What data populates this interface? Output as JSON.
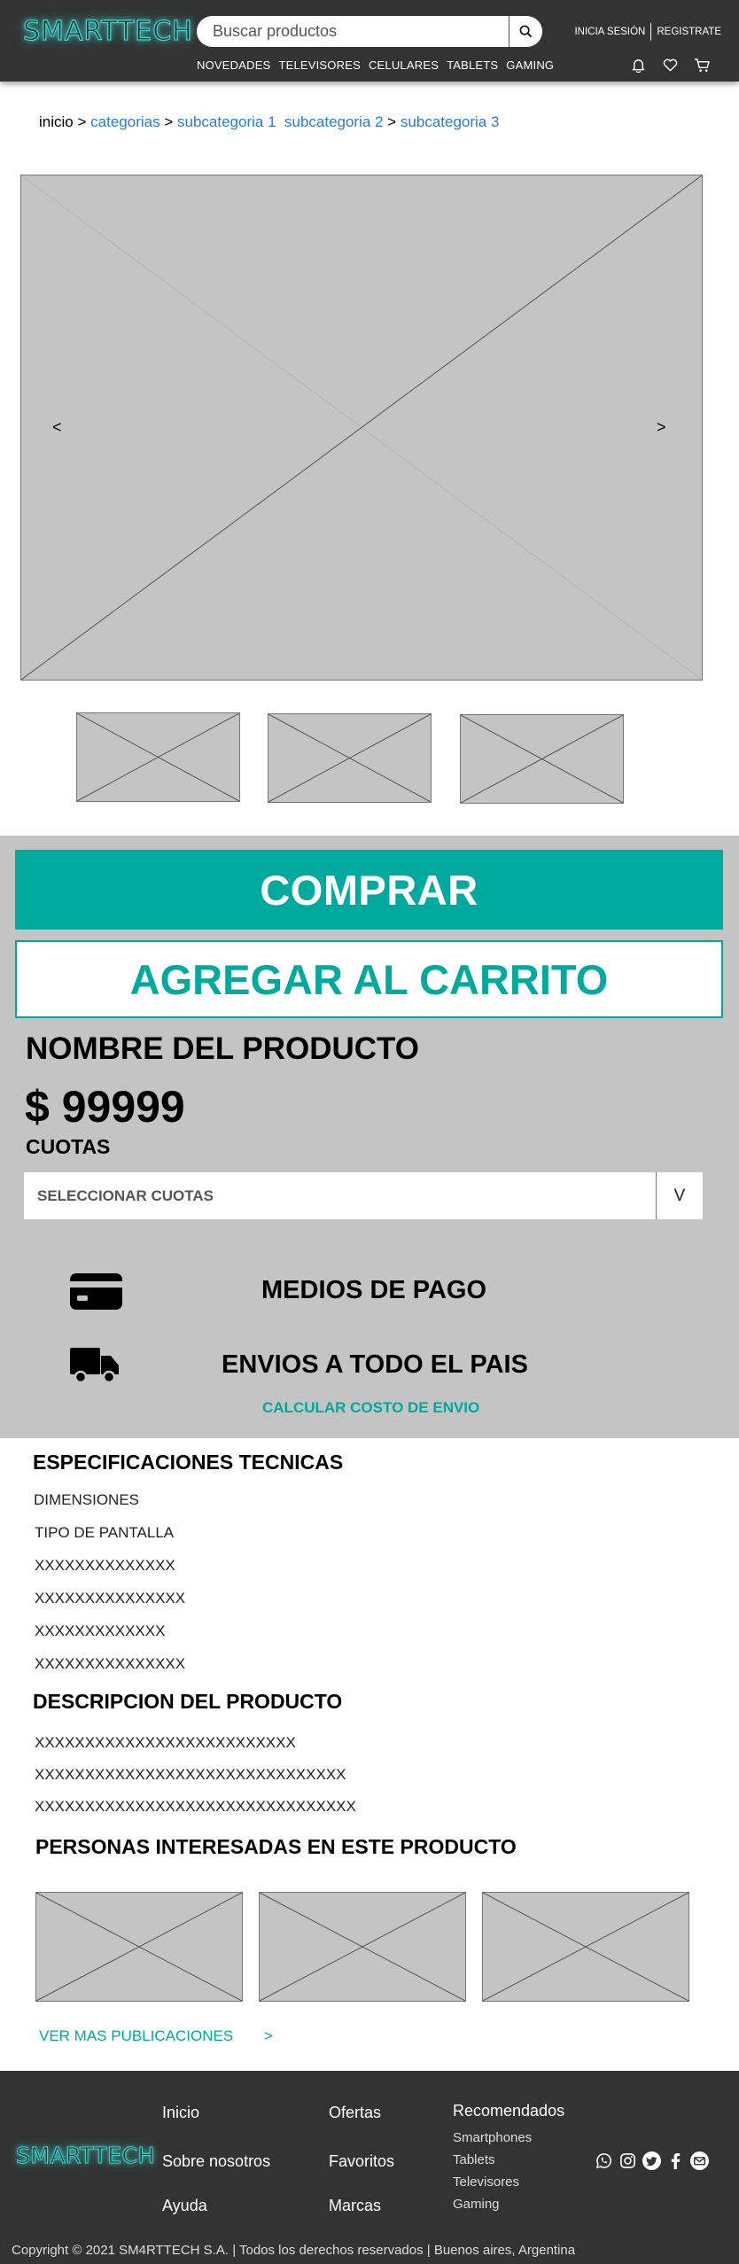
{
  "header": {
    "logo": "SMARTTECH",
    "search_placeholder": "Buscar productos",
    "nav": [
      "NOVEDADES",
      "TELEVISORES",
      "CELULARES",
      "TABLETS",
      "GAMING"
    ],
    "login": "INICIA SESIÓN",
    "register": "REGISTRATE",
    "icons": [
      "bell-icon",
      "heart-icon",
      "cart-icon"
    ]
  },
  "breadcrumb": {
    "home": "inicio",
    "sep": ">",
    "items": [
      "categorias",
      "subcategoria 1",
      "subcategoria 2",
      "subcategoria 3"
    ]
  },
  "gallery": {
    "prev": "<",
    "next": ">"
  },
  "product": {
    "buy_label": "COMPRAR",
    "cart_label": "AGREGAR AL CARRITO",
    "name": "NOMBRE DEL PRODUCTO",
    "price": "$ 99999",
    "cuotas_label": "CUOTAS",
    "cuotas_select": "SELECCIONAR CUOTAS",
    "cuotas_caret": "V",
    "payment": "MEDIOS DE PAGO",
    "shipping": "ENVIOS A TODO EL PAIS",
    "calc_shipping": "CALCULAR COSTO DE ENVIO"
  },
  "specs": {
    "title": "ESPECIFICACIONES TECNICAS",
    "items": [
      "DIMENSIONES",
      "TIPO DE PANTALLA",
      "XXXXXXXXXXXXXX",
      "XXXXXXXXXXXXXXX",
      "XXXXXXXXXXXXX",
      "XXXXXXXXXXXXXXX"
    ]
  },
  "description": {
    "title": "DESCRIPCION DEL PRODUCTO",
    "lines": [
      "XXXXXXXXXXXXXXXXXXXXXXXXXX",
      "XXXXXXXXXXXXXXXXXXXXXXXXXXXXXXX",
      "XXXXXXXXXXXXXXXXXXXXXXXXXXXXXXXX"
    ]
  },
  "interested": {
    "title": "PERSONAS INTERESADAS EN ESTE PRODUCTO",
    "more": "VER MAS PUBLICACIONES",
    "more_arrow": ">"
  },
  "footer": {
    "logo": "SMARTTECH",
    "col1": [
      "Inicio",
      "Sobre nosotros",
      "Ayuda"
    ],
    "col2": [
      "Ofertas",
      "Favoritos",
      "Marcas"
    ],
    "col3_title": "Recomendados",
    "col3": [
      "Smartphones",
      "Tablets",
      "Televisores",
      "Gaming"
    ],
    "social": [
      "whatsapp-icon",
      "instagram-icon",
      "twitter-icon",
      "facebook-icon",
      "mail-icon"
    ],
    "copyright": "Copyright © 2021 SM4RTTECH S.A. | Todos los derechos reservados | Buenos aires, Argentina"
  },
  "colors": {
    "header_bg": "#333333",
    "accent": "#00a99d",
    "link": "#2a7ad8",
    "panel_gray": "#c4c4c4",
    "logo_glow": "#3fd6ce"
  }
}
